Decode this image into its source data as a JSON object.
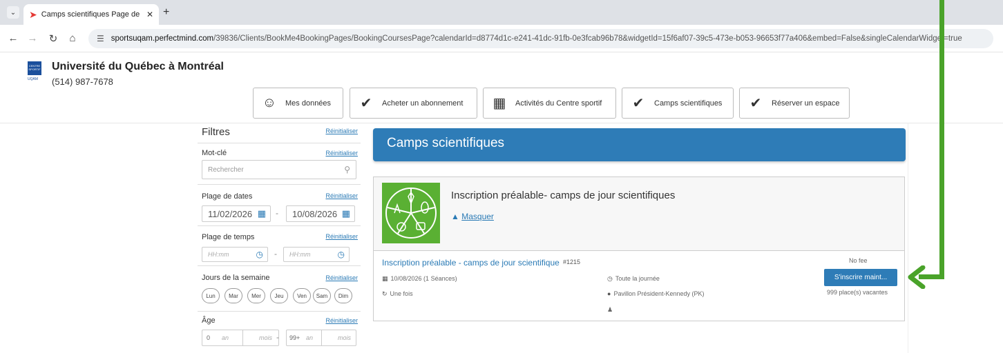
{
  "browser": {
    "tab_title": "Camps scientifiques Page de ré",
    "url_host": "sportsuqam.perfectmind.com",
    "url_path": "/39836/Clients/BookMe4BookingPages/BookingCoursesPage?calendarId=d8774d1c-e241-41dc-91fb-0e3fcab96b78&widgetId=15f6af07-39c5-473e-b053-96653f77a406&embed=False&singleCalendarWidget=true"
  },
  "header": {
    "logo_text": "CENTRE SPORTIF",
    "logo_sub": "UQÀM",
    "university": "Université du Québec à Montréal",
    "phone": "(514) 987-7678"
  },
  "nav": [
    {
      "label": "Mes données",
      "icon": "user-circle-icon"
    },
    {
      "label": "Acheter un abonnement",
      "icon": "checkmark-circle-icon"
    },
    {
      "label": "Activités du Centre sportif",
      "icon": "calendar-icon"
    },
    {
      "label": "Camps scientifiques",
      "icon": "checkmark-circle-icon"
    },
    {
      "label": "Réserver un espace",
      "icon": "checkmark-circle-icon"
    }
  ],
  "filters": {
    "title": "Filtres",
    "reset": "Réinitialiser",
    "keyword_label": "Mot-clé",
    "search_placeholder": "Rechercher",
    "date_label": "Plage de dates",
    "date_from": "11/02/2026",
    "date_to": "10/08/2026",
    "time_label": "Plage de temps",
    "time_placeholder": "HH:mm",
    "days_label": "Jours de la semaine",
    "days": [
      "Lun",
      "Mar",
      "Mer",
      "Jeu",
      "Ven",
      "Sam",
      "Dim"
    ],
    "age_label": "Âge",
    "age_min": "0",
    "age_max": "99+",
    "age_unit_years": "an",
    "age_unit_months": "mois"
  },
  "main": {
    "panel_title": "Camps scientifiques",
    "category_title": "Inscription préalable- camps de jour scientifiques",
    "toggle_label": "Masquer",
    "course_name": "Inscription préalable - camps de jour scientifique",
    "course_number": "#1215",
    "date_info": "10/08/2026 (1 Séances)",
    "frequency": "Une fois",
    "time_info": "Toute la journée",
    "location": "Pavillon Président-Kennedy (PK)",
    "fee": "No fee",
    "register_label": "S'inscrire maint...",
    "places": "999 place(s) vacantes"
  },
  "colors": {
    "accent": "#2e7cb7",
    "annotation_arrow": "#4aa32a",
    "category_image": "#5ab033"
  }
}
